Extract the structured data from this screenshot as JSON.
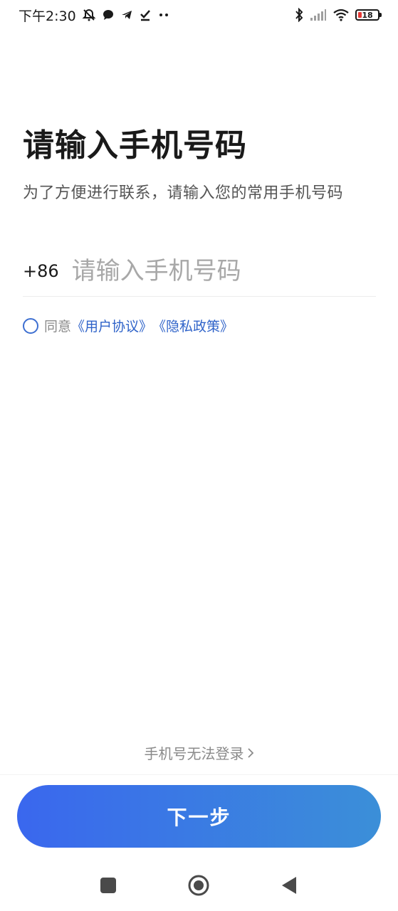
{
  "status_bar": {
    "time": "下午2:30",
    "battery_level": "18",
    "icons": [
      "mute-bell-icon",
      "chat-bubble-icon",
      "telegram-icon",
      "check-icon",
      "more-dots-icon",
      "bluetooth-icon",
      "signal-icon",
      "wifi-icon",
      "battery-icon"
    ]
  },
  "header": {
    "title": "请输入手机号码",
    "subtitle": "为了方便进行联系，请输入您的常用手机号码"
  },
  "phone": {
    "country_code": "+86",
    "placeholder": "请输入手机号码",
    "value": ""
  },
  "agreement": {
    "prefix": "同意",
    "user_agreement": "《用户协议》",
    "privacy_policy": "《隐私政策》"
  },
  "cannot_login": {
    "label": "手机号无法登录",
    "chevron": ">"
  },
  "next_button": {
    "label": "下一步"
  },
  "colors": {
    "accent": "#3a67ee",
    "accent_end": "#3b8fd8",
    "link": "#2f63c9",
    "placeholder": "#a8a8a8"
  },
  "nav_bar": {
    "icons": [
      "recent-apps-icon",
      "home-icon",
      "back-icon"
    ]
  }
}
